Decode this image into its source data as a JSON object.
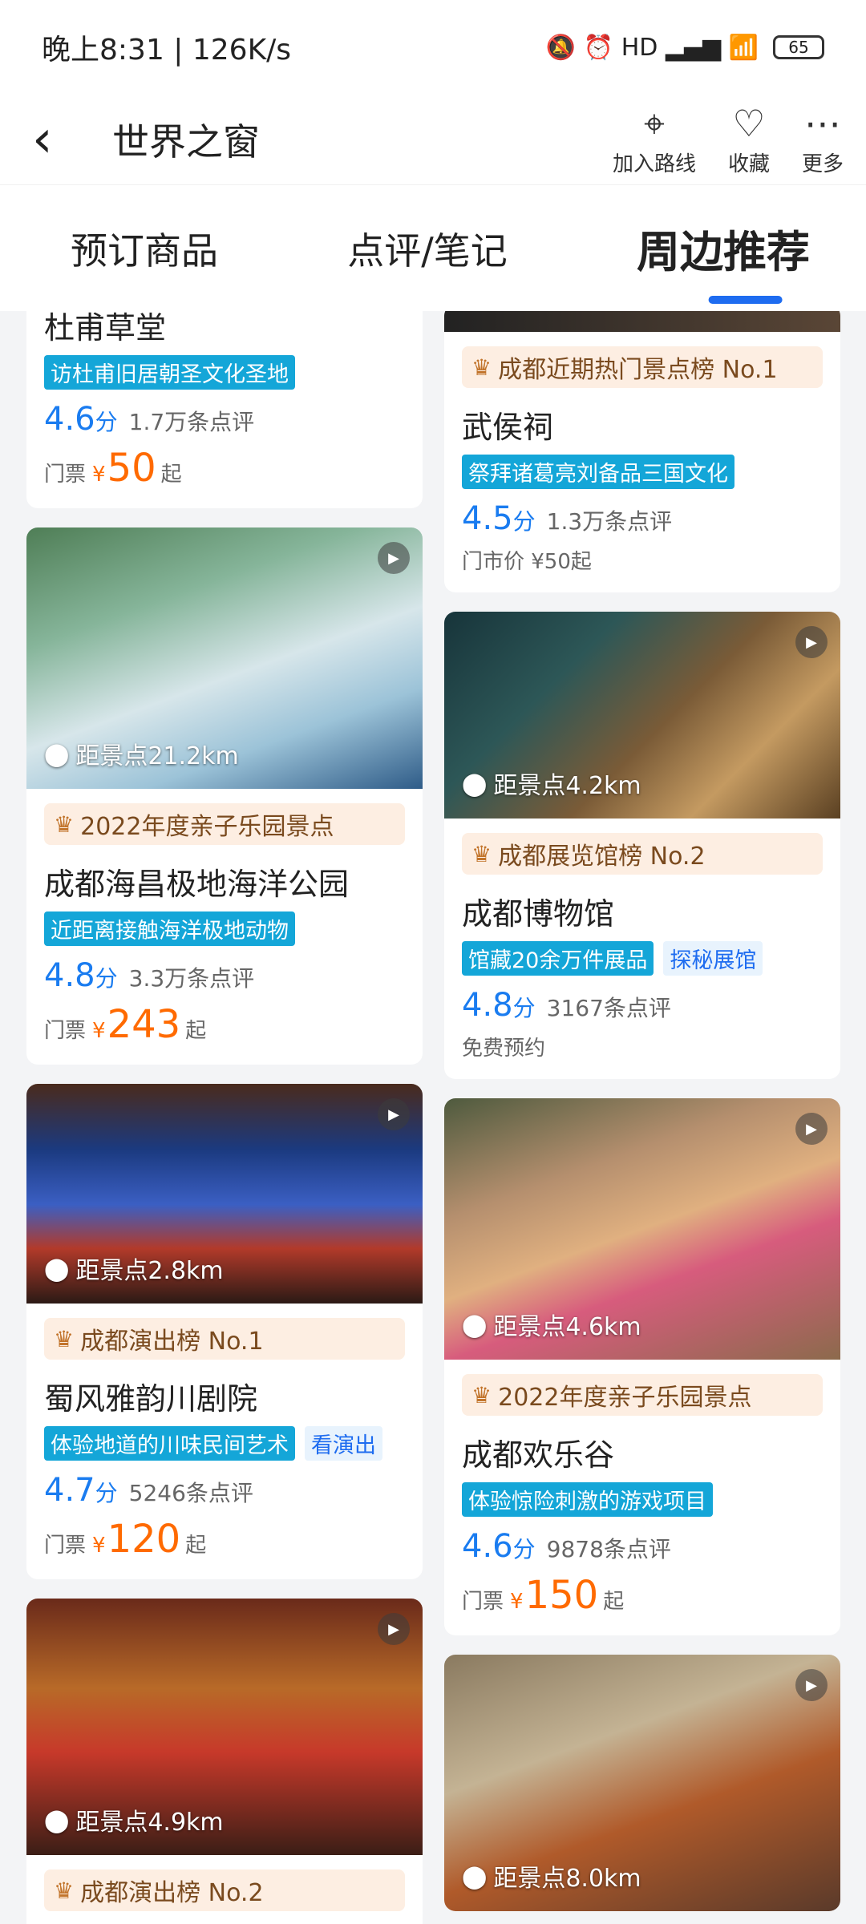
{
  "status_bar": {
    "time": "晚上8:31 | 126K/s",
    "icons": "🔕 ⏰ HD ▂▄▆ 📶",
    "battery": "65"
  },
  "header": {
    "title": "世界之窗",
    "actions": [
      {
        "label": "加入路线",
        "icon": "route-add-icon"
      },
      {
        "label": "收藏",
        "icon": "heart-icon"
      },
      {
        "label": "更多",
        "icon": "more-icon"
      }
    ]
  },
  "tabs": [
    {
      "label": "预订商品",
      "active": false
    },
    {
      "label": "点评/笔记",
      "active": false
    },
    {
      "label": "周边推荐",
      "active": true
    }
  ],
  "left_column": [
    {
      "name": "杜甫草堂",
      "tags": [
        "访杜甫旧居朝圣文化圣地"
      ],
      "score": "4.6",
      "score_unit": "分",
      "reviews": "1.7万条点评",
      "price_prefix": "门票",
      "price_currency": "¥",
      "price": "50",
      "price_suffix": "起"
    },
    {
      "distance": "距景点21.2km",
      "rank": "2022年度亲子乐园景点",
      "name": "成都海昌极地海洋公园",
      "tags": [
        "近距离接触海洋极地动物"
      ],
      "score": "4.8",
      "score_unit": "分",
      "reviews": "3.3万条点评",
      "price_prefix": "门票",
      "price_currency": "¥",
      "price": "243",
      "price_suffix": "起"
    },
    {
      "distance": "距景点2.8km",
      "rank": "成都演出榜 No.1",
      "name": "蜀风雅韵川剧院",
      "tags": [
        "体验地道的川味民间艺术"
      ],
      "light_tag": "看演出",
      "score": "4.7",
      "score_unit": "分",
      "reviews": "5246条点评",
      "price_prefix": "门票",
      "price_currency": "¥",
      "price": "120",
      "price_suffix": "起"
    },
    {
      "distance": "距景点4.9km",
      "rank": "成都演出榜 No.2"
    }
  ],
  "right_column": [
    {
      "rank": "成都近期热门景点榜 No.1",
      "name": "武侯祠",
      "tags": [
        "祭拜诸葛亮刘备品三国文化"
      ],
      "score": "4.5",
      "score_unit": "分",
      "reviews": "1.3万条点评",
      "price_text": "门市价 ¥50起"
    },
    {
      "distance": "距景点4.2km",
      "rank": "成都展览馆榜 No.2",
      "name": "成都博物馆",
      "tags": [
        "馆藏20余万件展品"
      ],
      "light_tag": "探秘展馆",
      "score": "4.8",
      "score_unit": "分",
      "reviews": "3167条点评",
      "price_text": "免费预约"
    },
    {
      "distance": "距景点4.6km",
      "rank": "2022年度亲子乐园景点",
      "name": "成都欢乐谷",
      "tags": [
        "体验惊险刺激的游戏项目"
      ],
      "score": "4.6",
      "score_unit": "分",
      "reviews": "9878条点评",
      "price_prefix": "门票",
      "price_currency": "¥",
      "price": "150",
      "price_suffix": "起"
    },
    {
      "distance": "距景点8.0km"
    }
  ],
  "colors": {
    "accent_blue": "#1e6cf0",
    "price_orange": "#ff6a00",
    "tag_teal": "#14a6d8",
    "rank_bg": "#fdeee2"
  }
}
